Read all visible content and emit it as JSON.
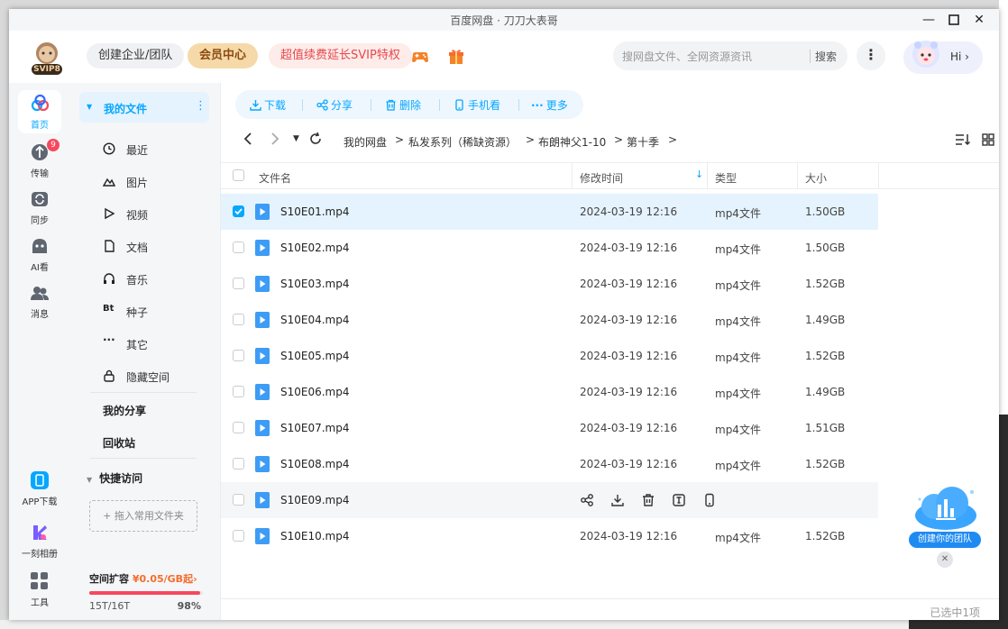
{
  "window": {
    "title": "百度网盘 · 刀刀大表哥"
  },
  "header": {
    "svip_badge": "SVIP8",
    "create_team": "创建企业/团队",
    "member_center": "会员中心",
    "promo": "超值续费延长SVIP特权",
    "search_placeholder": "搜网盘文件、全网资源资讯",
    "search_button": "搜索",
    "more": "⋮",
    "greeting": "Hi ›"
  },
  "rail": {
    "items": [
      {
        "label": "首页",
        "icon": "home-icon"
      },
      {
        "label": "传输",
        "icon": "transfer-icon",
        "badge": "9"
      },
      {
        "label": "同步",
        "icon": "sync-icon"
      },
      {
        "label": "AI看",
        "icon": "ai-icon"
      },
      {
        "label": "消息",
        "icon": "message-icon"
      }
    ],
    "bottom": [
      {
        "label": "APP下载",
        "icon": "phone-icon"
      },
      {
        "label": "一刻相册",
        "icon": "album-icon"
      },
      {
        "label": "工具",
        "icon": "tools-icon"
      }
    ]
  },
  "nav": {
    "my_files": "我的文件",
    "subs": [
      {
        "label": "最近",
        "icon": "clock-icon"
      },
      {
        "label": "图片",
        "icon": "image-icon"
      },
      {
        "label": "视频",
        "icon": "video-icon"
      },
      {
        "label": "文档",
        "icon": "document-icon"
      },
      {
        "label": "音乐",
        "icon": "music-icon"
      },
      {
        "label": "种子",
        "icon": "torrent-icon",
        "glyph": "Bt"
      },
      {
        "label": "其它",
        "icon": "other-icon",
        "glyph": "···"
      },
      {
        "label": "隐藏空间",
        "icon": "lock-icon"
      }
    ],
    "my_share": "我的分享",
    "recycle": "回收站",
    "quick_access": "快捷访问",
    "drop_hint": "+ 拖入常用文件夹",
    "space_label": "空间扩容",
    "space_price": "¥0.05/GB起",
    "space_arrow": "›",
    "space_usage": "15T/16T",
    "space_percent": "98%",
    "space_fraction": 0.98
  },
  "toolbar": {
    "download": "下载",
    "share": "分享",
    "delete": "删除",
    "phone": "手机看",
    "more": "更多"
  },
  "breadcrumb": {
    "items": [
      "我的网盘",
      "私发系列（稀缺资源）",
      "布朗神父1-10",
      "第十季"
    ],
    "sep": ">"
  },
  "table": {
    "headers": {
      "name": "文件名",
      "time": "修改时间",
      "type": "类型",
      "size": "大小"
    },
    "rows": [
      {
        "name": "S10E01.mp4",
        "time": "2024-03-19 12:16",
        "type": "mp4文件",
        "size": "1.50GB",
        "checked": true
      },
      {
        "name": "S10E02.mp4",
        "time": "2024-03-19 12:16",
        "type": "mp4文件",
        "size": "1.50GB"
      },
      {
        "name": "S10E03.mp4",
        "time": "2024-03-19 12:16",
        "type": "mp4文件",
        "size": "1.52GB"
      },
      {
        "name": "S10E04.mp4",
        "time": "2024-03-19 12:16",
        "type": "mp4文件",
        "size": "1.49GB"
      },
      {
        "name": "S10E05.mp4",
        "time": "2024-03-19 12:16",
        "type": "mp4文件",
        "size": "1.52GB"
      },
      {
        "name": "S10E06.mp4",
        "time": "2024-03-19 12:16",
        "type": "mp4文件",
        "size": "1.49GB"
      },
      {
        "name": "S10E07.mp4",
        "time": "2024-03-19 12:16",
        "type": "mp4文件",
        "size": "1.51GB"
      },
      {
        "name": "S10E08.mp4",
        "time": "2024-03-19 12:16",
        "type": "mp4文件",
        "size": "1.52GB"
      },
      {
        "name": "S10E09.mp4",
        "time": "",
        "type": "",
        "size": "",
        "hover": true
      },
      {
        "name": "S10E10.mp4",
        "time": "2024-03-19 12:16",
        "type": "mp4文件",
        "size": "1.52GB"
      }
    ]
  },
  "status": {
    "selected": "已选中1项"
  },
  "promo_widget": {
    "label": "创建你的团队",
    "close": "✕"
  },
  "colors": {
    "accent": "#06a7ff",
    "badge": "#f7485e",
    "gold": "#f6d9a8"
  }
}
